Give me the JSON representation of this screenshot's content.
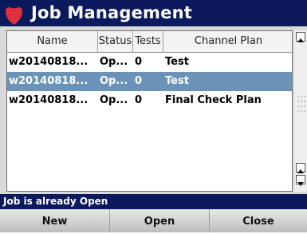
{
  "title": {
    "text": "Job Management",
    "logo_icon": "red-shield-logo"
  },
  "table": {
    "columns": [
      "Name",
      "Status",
      "Tests",
      "Channel Plan"
    ],
    "rows": [
      {
        "name": "w20140818...",
        "status": "Op...",
        "tests": "0",
        "plan": "Test",
        "selected": false
      },
      {
        "name": "w20140818...",
        "status": "Op...",
        "tests": "0",
        "plan": "Test",
        "selected": true
      },
      {
        "name": "w20140818...",
        "status": "Op...",
        "tests": "0",
        "plan": "Final Check Plan",
        "selected": false
      }
    ]
  },
  "status_message": "Job is already Open",
  "buttons": {
    "new": "New",
    "open": "Open",
    "close": "Close"
  },
  "colors": {
    "title_bg": "#0b1a5c",
    "selection": "#6b93b8",
    "logo": "#e0303b"
  }
}
